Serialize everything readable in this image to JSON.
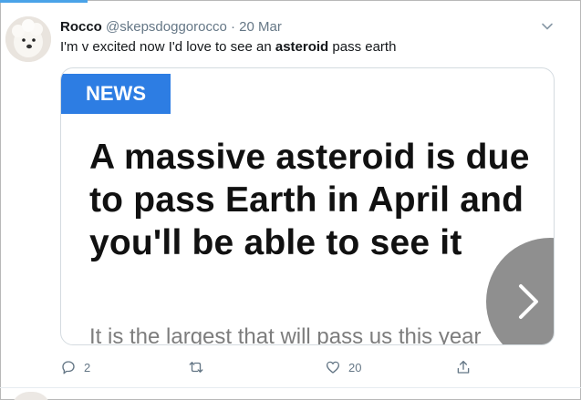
{
  "tweet": {
    "author_name": "Rocco",
    "handle": "@skepsdoggorocco",
    "separator": "·",
    "date": "20 Mar",
    "text_before": "I'm v excited now I'd love to see an ",
    "text_bold": "asteroid",
    "text_after": " pass earth"
  },
  "card": {
    "badge": "NEWS",
    "headline": "A massive asteroid is due to pass Earth in April and you'll be able to see it",
    "subline": "It is the largest that will pass us this year"
  },
  "actions": {
    "reply_count": "2",
    "retweet_count": "",
    "like_count": "20"
  },
  "colors": {
    "accent": "#4aa3e8",
    "badge": "#2d7de3",
    "muted": "#657786"
  },
  "icons": [
    "avatar-dog",
    "chevron-down-icon",
    "chevron-right-icon",
    "reply-icon",
    "retweet-icon",
    "like-icon",
    "share-icon"
  ]
}
